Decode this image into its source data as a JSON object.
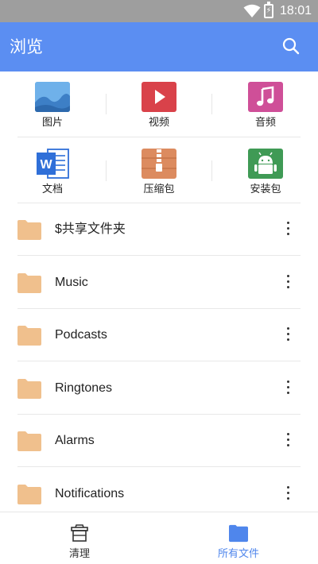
{
  "status_bar": {
    "time": "18:01"
  },
  "app_bar": {
    "title": "浏览"
  },
  "categories": [
    {
      "label": "图片",
      "icon": "image-icon",
      "color": "#5ba2e2"
    },
    {
      "label": "视频",
      "icon": "video-icon",
      "color": "#d9424a"
    },
    {
      "label": "音频",
      "icon": "music-icon",
      "color": "#cf4f98"
    },
    {
      "label": "文档",
      "icon": "word-document-icon",
      "color": "#2f6fd8"
    },
    {
      "label": "压缩包",
      "icon": "zip-archive-icon",
      "color": "#dc8b5f"
    },
    {
      "label": "安装包",
      "icon": "android-apk-icon",
      "color": "#3f9a55"
    }
  ],
  "folders": [
    {
      "name": "$共享文件夹"
    },
    {
      "name": "Music"
    },
    {
      "name": "Podcasts"
    },
    {
      "name": "Ringtones"
    },
    {
      "name": "Alarms"
    },
    {
      "name": "Notifications"
    }
  ],
  "bottom_nav": {
    "tabs": [
      {
        "label": "清理",
        "icon": "broom-basket-icon",
        "color": "#333333"
      },
      {
        "label": "所有文件",
        "icon": "folder-icon",
        "color": "#4f86ec",
        "selected": true
      }
    ]
  },
  "colors": {
    "accent": "#5b8ef2",
    "folder": "#f0c08d",
    "status_bar": "#9e9e9e"
  }
}
